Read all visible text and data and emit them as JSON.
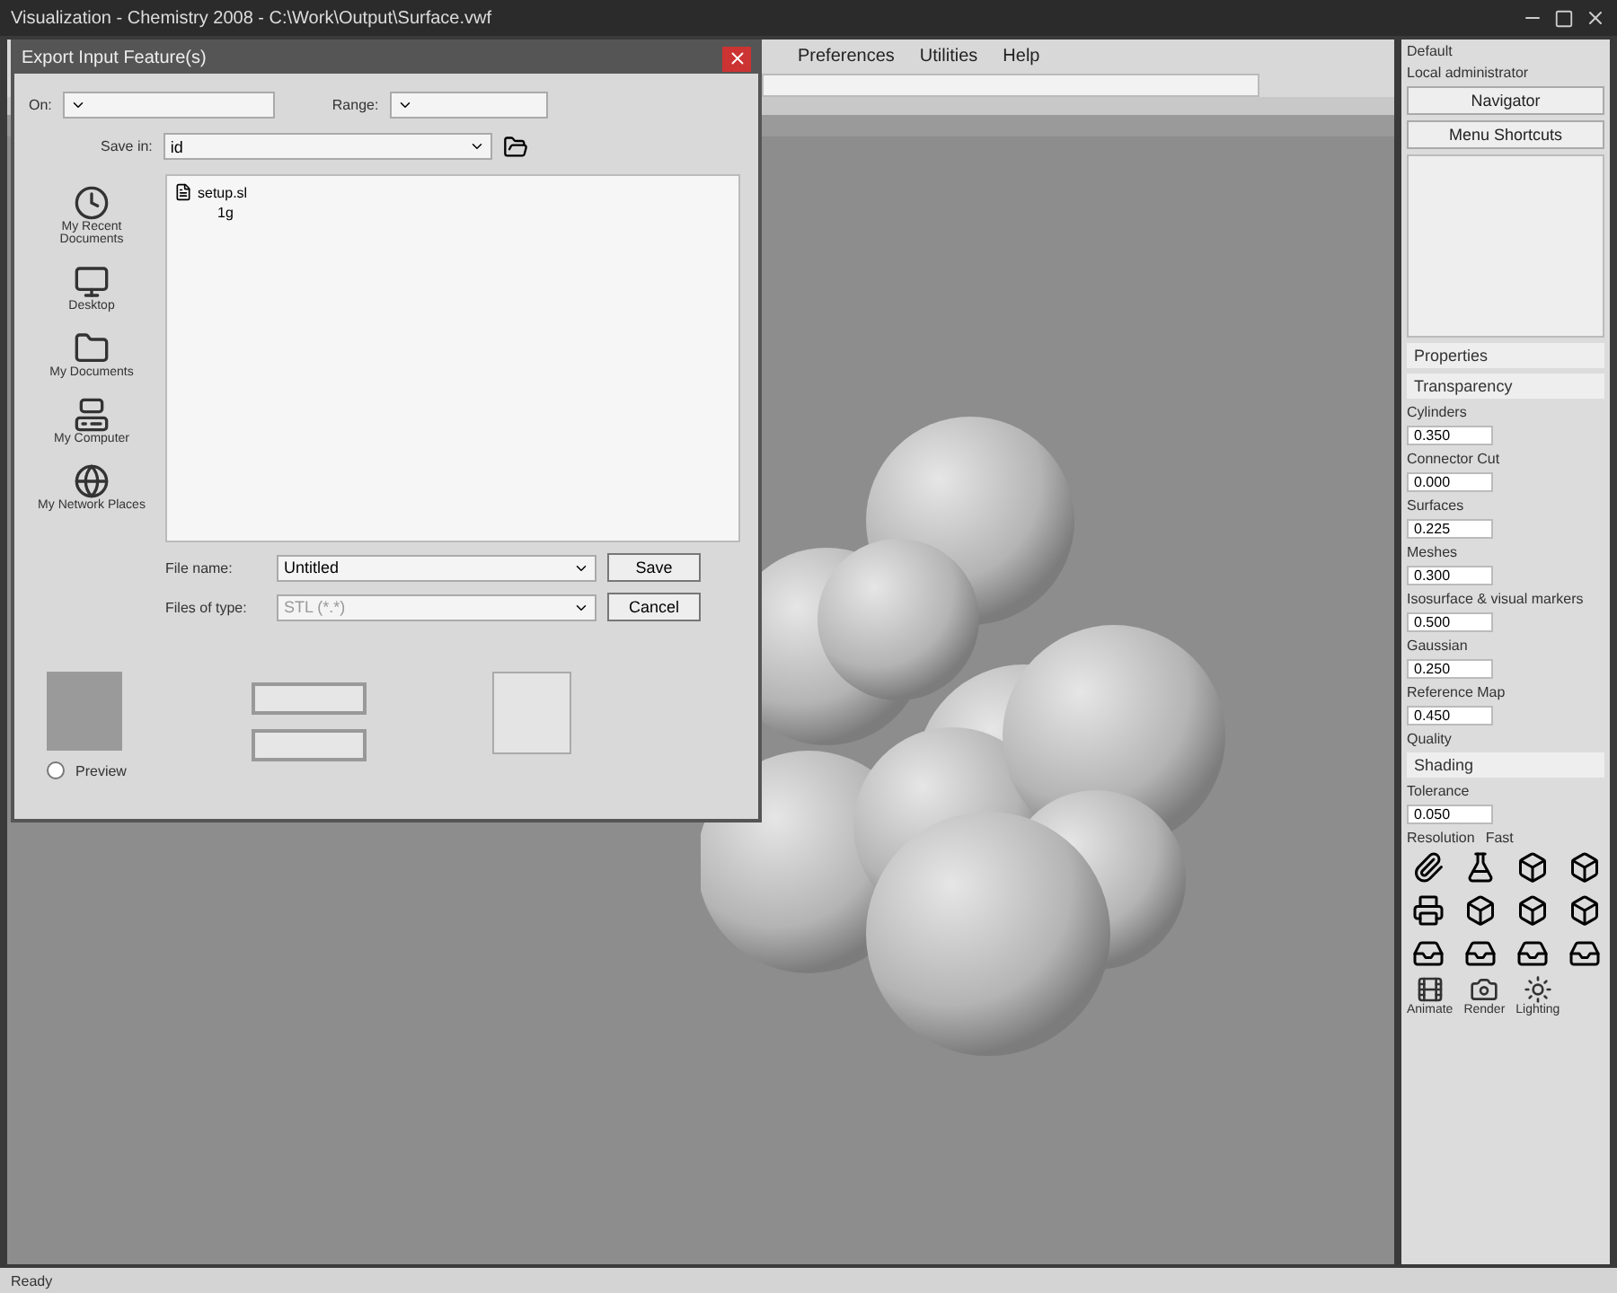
{
  "window": {
    "title": "Visualization - Chemistry 2008 - C:\\Work\\Output\\Surface.vwf"
  },
  "menu": [
    "Preferences",
    "Utilities",
    "Help"
  ],
  "user": {
    "name": "Default",
    "role": "Local administrator"
  },
  "side_buttons": [
    "Navigator",
    "Menu Shortcuts"
  ],
  "properties_title": "Properties",
  "transparency": {
    "title": "Transparency",
    "fields": [
      {
        "label": "Cylinders",
        "value": "0.350"
      },
      {
        "label": "Connector Cut",
        "value": "0.000"
      },
      {
        "label": "Surfaces",
        "value": "0.225"
      },
      {
        "label": "Meshes",
        "value": "0.300"
      },
      {
        "label": "Isosurface & visual markers",
        "value": "0.500"
      },
      {
        "label": "Gaussian",
        "value": "0.250"
      },
      {
        "label": "Reference Map",
        "value": "0.450"
      }
    ]
  },
  "quality": {
    "label": "Quality"
  },
  "shading": {
    "title": "Shading",
    "tolerance_label": "Tolerance",
    "tolerance": "0.050",
    "resolution": "Resolution",
    "fast": "Fast"
  },
  "tool_icons": [
    {
      "kind": "clip"
    },
    {
      "kind": "flask"
    },
    {
      "kind": "cube"
    },
    {
      "kind": "cube"
    },
    {
      "kind": "print"
    },
    {
      "kind": "cube"
    },
    {
      "kind": "cube"
    },
    {
      "kind": "cube"
    },
    {
      "kind": "tray"
    },
    {
      "kind": "tray"
    },
    {
      "kind": "tray"
    },
    {
      "kind": "tray"
    }
  ],
  "actions": [
    "Animate",
    "Render",
    "Lighting"
  ],
  "status": "Ready",
  "dialog": {
    "title": "Export Input Feature(s)",
    "on_label": "On:",
    "range_label": "Range:",
    "save_in_label": "Save in:",
    "save_in": "id",
    "places": [
      {
        "label": "My Recent Documents",
        "kind": "recent"
      },
      {
        "label": "Desktop",
        "kind": "desktop"
      },
      {
        "label": "My Documents",
        "kind": "docs"
      },
      {
        "label": "My Computer",
        "kind": "computer"
      },
      {
        "label": "My Network Places",
        "kind": "network"
      }
    ],
    "files": [
      {
        "name": "setup.sl",
        "children": [
          {
            "name": "1g"
          }
        ]
      }
    ],
    "file_name_label": "File name:",
    "file_name": "Untitled",
    "file_type_label": "Files of type:",
    "file_type": "STL (*.*)",
    "buttons": [
      "Save",
      "Cancel"
    ],
    "preview": {
      "label": "Preview",
      "checked": false
    }
  }
}
